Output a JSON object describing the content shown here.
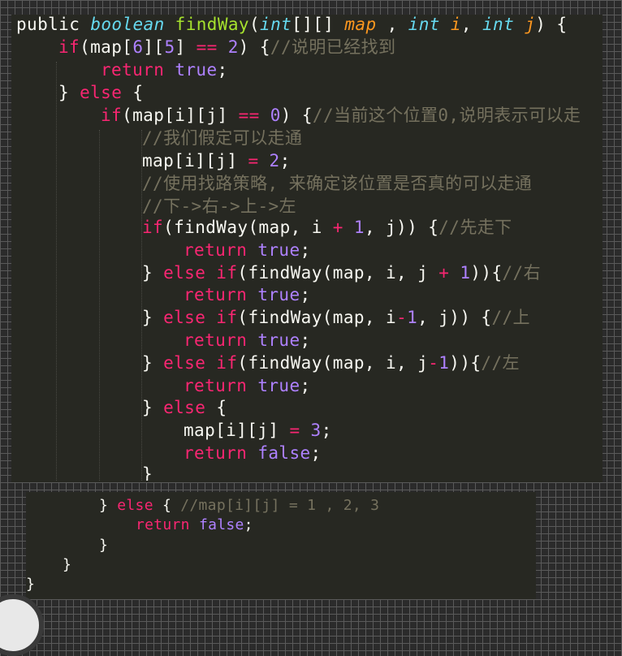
{
  "editor_top": {
    "lines": [
      [
        {
          "c": "t",
          "s": "public "
        },
        {
          "c": "ty",
          "s": "boolean"
        },
        {
          "c": "t",
          "s": " "
        },
        {
          "c": "fn",
          "s": "findWay"
        },
        {
          "c": "t",
          "s": "("
        },
        {
          "c": "ty",
          "s": "int"
        },
        {
          "c": "t",
          "s": "[][] "
        },
        {
          "c": "par",
          "s": "map"
        },
        {
          "c": "t",
          "s": " , "
        },
        {
          "c": "ty",
          "s": "int"
        },
        {
          "c": "t",
          "s": " "
        },
        {
          "c": "par",
          "s": "i"
        },
        {
          "c": "t",
          "s": ", "
        },
        {
          "c": "ty",
          "s": "int"
        },
        {
          "c": "t",
          "s": " "
        },
        {
          "c": "par",
          "s": "j"
        },
        {
          "c": "t",
          "s": ") {"
        }
      ],
      [
        {
          "c": "kw",
          "s": "if"
        },
        {
          "c": "t",
          "s": "(map["
        },
        {
          "c": "num",
          "s": "6"
        },
        {
          "c": "t",
          "s": "]["
        },
        {
          "c": "num",
          "s": "5"
        },
        {
          "c": "t",
          "s": "] "
        },
        {
          "c": "kw",
          "s": "=="
        },
        {
          "c": "t",
          "s": " "
        },
        {
          "c": "num",
          "s": "2"
        },
        {
          "c": "t",
          "s": ") {"
        },
        {
          "c": "cm",
          "s": "//说明已经找到"
        }
      ],
      [
        {
          "c": "kw",
          "s": "return"
        },
        {
          "c": "t",
          "s": " "
        },
        {
          "c": "bool",
          "s": "true"
        },
        {
          "c": "t",
          "s": ";"
        }
      ],
      [
        {
          "c": "t",
          "s": "} "
        },
        {
          "c": "kw",
          "s": "else"
        },
        {
          "c": "t",
          "s": " {"
        }
      ],
      [
        {
          "c": "kw",
          "s": "if"
        },
        {
          "c": "t",
          "s": "(map[i][j] "
        },
        {
          "c": "kw",
          "s": "=="
        },
        {
          "c": "t",
          "s": " "
        },
        {
          "c": "num",
          "s": "0"
        },
        {
          "c": "t",
          "s": ") {"
        },
        {
          "c": "cm",
          "s": "//当前这个位置0,说明表示可以走"
        }
      ],
      [
        {
          "c": "cm",
          "s": "//我们假定可以走通"
        }
      ],
      [
        {
          "c": "t",
          "s": "map[i][j] "
        },
        {
          "c": "kw",
          "s": "="
        },
        {
          "c": "t",
          "s": " "
        },
        {
          "c": "num",
          "s": "2"
        },
        {
          "c": "t",
          "s": ";"
        }
      ],
      [
        {
          "c": "cm",
          "s": "//使用找路策略, 来确定该位置是否真的可以走通"
        }
      ],
      [
        {
          "c": "cm",
          "s": "//下->右->上->左"
        }
      ],
      [
        {
          "c": "kw",
          "s": "if"
        },
        {
          "c": "t",
          "s": "(findWay(map, i "
        },
        {
          "c": "kw",
          "s": "+"
        },
        {
          "c": "t",
          "s": " "
        },
        {
          "c": "num",
          "s": "1"
        },
        {
          "c": "t",
          "s": ", j)) {"
        },
        {
          "c": "cm",
          "s": "//先走下"
        }
      ],
      [
        {
          "c": "kw",
          "s": "return"
        },
        {
          "c": "t",
          "s": " "
        },
        {
          "c": "bool",
          "s": "true"
        },
        {
          "c": "t",
          "s": ";"
        }
      ],
      [
        {
          "c": "t",
          "s": "} "
        },
        {
          "c": "kw",
          "s": "else if"
        },
        {
          "c": "t",
          "s": "(findWay(map, i, j "
        },
        {
          "c": "kw",
          "s": "+"
        },
        {
          "c": "t",
          "s": " "
        },
        {
          "c": "num",
          "s": "1"
        },
        {
          "c": "t",
          "s": ")){"
        },
        {
          "c": "cm",
          "s": "//右"
        }
      ],
      [
        {
          "c": "kw",
          "s": "return"
        },
        {
          "c": "t",
          "s": " "
        },
        {
          "c": "bool",
          "s": "true"
        },
        {
          "c": "t",
          "s": ";"
        }
      ],
      [
        {
          "c": "t",
          "s": "} "
        },
        {
          "c": "kw",
          "s": "else if"
        },
        {
          "c": "t",
          "s": "(findWay(map, i"
        },
        {
          "c": "kw",
          "s": "-"
        },
        {
          "c": "num",
          "s": "1"
        },
        {
          "c": "t",
          "s": ", j)) {"
        },
        {
          "c": "cm",
          "s": "//上"
        }
      ],
      [
        {
          "c": "kw",
          "s": "return"
        },
        {
          "c": "t",
          "s": " "
        },
        {
          "c": "bool",
          "s": "true"
        },
        {
          "c": "t",
          "s": ";"
        }
      ],
      [
        {
          "c": "t",
          "s": "} "
        },
        {
          "c": "kw",
          "s": "else if"
        },
        {
          "c": "t",
          "s": "(findWay(map, i, j"
        },
        {
          "c": "kw",
          "s": "-"
        },
        {
          "c": "num",
          "s": "1"
        },
        {
          "c": "t",
          "s": ")){"
        },
        {
          "c": "cm",
          "s": "//左"
        }
      ],
      [
        {
          "c": "kw",
          "s": "return"
        },
        {
          "c": "t",
          "s": " "
        },
        {
          "c": "bool",
          "s": "true"
        },
        {
          "c": "t",
          "s": ";"
        }
      ],
      [
        {
          "c": "t",
          "s": "} "
        },
        {
          "c": "kw",
          "s": "else"
        },
        {
          "c": "t",
          "s": " {"
        }
      ],
      [
        {
          "c": "t",
          "s": "map[i][j] "
        },
        {
          "c": "kw",
          "s": "="
        },
        {
          "c": "t",
          "s": " "
        },
        {
          "c": "num",
          "s": "3"
        },
        {
          "c": "t",
          "s": ";"
        }
      ],
      [
        {
          "c": "kw",
          "s": "return"
        },
        {
          "c": "t",
          "s": " "
        },
        {
          "c": "bool",
          "s": "false"
        },
        {
          "c": "t",
          "s": ";"
        }
      ],
      [
        {
          "c": "t",
          "s": "}"
        }
      ]
    ]
  },
  "editor_bottom": {
    "lines": [
      [
        {
          "c": "t",
          "s": "} "
        },
        {
          "c": "kw",
          "s": "else"
        },
        {
          "c": "t",
          "s": " { "
        },
        {
          "c": "cm",
          "s": "//map[i][j] = 1 , 2, 3"
        }
      ],
      [
        {
          "c": "kw",
          "s": "return"
        },
        {
          "c": "t",
          "s": " "
        },
        {
          "c": "bool",
          "s": "false"
        },
        {
          "c": "t",
          "s": ";"
        }
      ],
      [
        {
          "c": "t",
          "s": "}"
        }
      ],
      [
        {
          "c": "t",
          "s": "}"
        }
      ],
      [
        {
          "c": "t",
          "s": "}"
        }
      ]
    ]
  },
  "theme": {
    "background": "#272822",
    "keyword": "#f92672",
    "type": "#66d9ef",
    "function": "#a6e22e",
    "number": "#ae81ff",
    "parameter": "#fd971f",
    "comment": "#75715e",
    "text": "#f8f8f2"
  }
}
